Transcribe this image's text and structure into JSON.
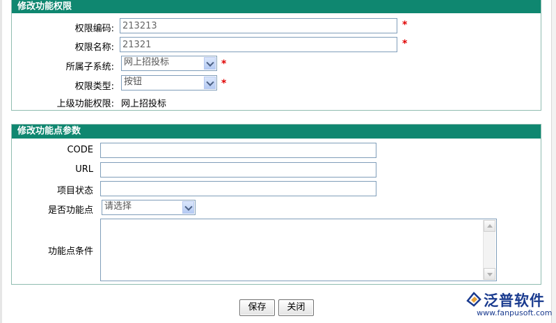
{
  "section1": {
    "title": "修改功能权限",
    "fields": {
      "code_label": "权限编码:",
      "code_value": "213213",
      "name_label": "权限名称:",
      "name_value": "21321",
      "subsystem_label": "所属子系统:",
      "subsystem_value": "网上招投标",
      "type_label": "权限类型:",
      "type_value": "按钮",
      "parent_label": "上级功能权限:",
      "parent_value": "网上招投标",
      "required_mark": "*"
    }
  },
  "section2": {
    "title": "修改功能点参数",
    "fields": {
      "code_label": "CODE",
      "code_value": "",
      "url_label": "URL",
      "url_value": "",
      "status_label": "项目状态",
      "status_value": "",
      "is_point_label": "是否功能点",
      "is_point_value": "请选择",
      "condition_label": "功能点条件",
      "condition_value": ""
    }
  },
  "buttons": {
    "save": "保存",
    "close": "关闭"
  },
  "watermark": {
    "brand": "泛普软件",
    "url": "www.fanpusoft.com",
    "brand_color": "#1a3b8f"
  },
  "colors": {
    "header_bg": "#0f8770",
    "required": "#e00000"
  }
}
